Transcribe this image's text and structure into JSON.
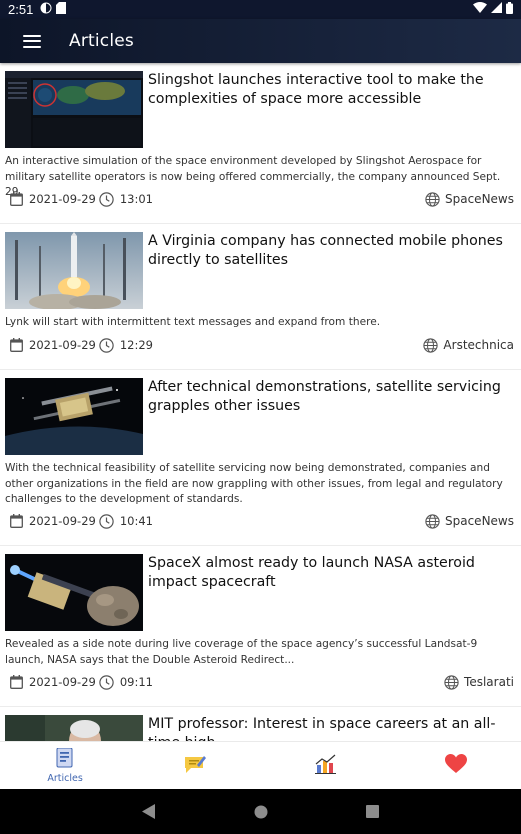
{
  "status_bar": {
    "time": "2:51"
  },
  "app_bar": {
    "title": "Articles"
  },
  "articles": [
    {
      "title": "Slingshot launches interactive tool to make the complexities of space more accessible",
      "summary": "An interactive simulation of the space environment developed by Slingshot Aerospace for military satellite operators is now being offered commercially, the company announced Sept. 29.",
      "date": "2021-09-29",
      "time": "13:01",
      "source": "SpaceNews"
    },
    {
      "title": "A Virginia company has connected mobile phones directly to satellites",
      "summary": "Lynk will start with intermittent text messages and expand from there.",
      "date": "2021-09-29",
      "time": "12:29",
      "source": "Arstechnica"
    },
    {
      "title": "After technical demonstrations, satellite servicing grapples other issues",
      "summary": "With the technical feasibility of satellite servicing now being demonstrated, companies and other organizations in the field are now grappling with other issues, from legal and regulatory challenges to the development of standards.",
      "date": "2021-09-29",
      "time": "10:41",
      "source": "SpaceNews"
    },
    {
      "title": "SpaceX almost ready to launch NASA asteroid impact spacecraft",
      "summary": "Revealed as a side note during live coverage of the space agency’s successful Landsat-9 launch, NASA says that the Double Asteroid Redirect...",
      "date": "2021-09-29",
      "time": "09:11",
      "source": "Teslarati"
    },
    {
      "title": "MIT professor: Interest in space careers at an all-time high",
      "summary": "",
      "date": "",
      "time": "",
      "source": ""
    }
  ],
  "bottom_nav": {
    "items": [
      {
        "label": "Articles",
        "icon": "articles-icon",
        "active": true
      },
      {
        "label": "",
        "icon": "blog-icon",
        "active": false
      },
      {
        "label": "",
        "icon": "chart-icon",
        "active": false
      },
      {
        "label": "",
        "icon": "heart-icon",
        "active": false
      }
    ]
  },
  "colors": {
    "app_bar_dark": "#0d1528",
    "app_bar_light": "#1d2a45",
    "active_nav": "#4066b0",
    "heart": "#ee4444"
  }
}
